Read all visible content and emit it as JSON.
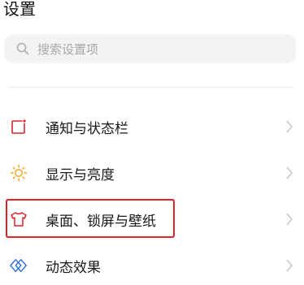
{
  "header": {
    "title": "设置"
  },
  "search": {
    "placeholder": "搜索设置项"
  },
  "settings": {
    "items": [
      {
        "label": "通知与状态栏",
        "icon": "notification-icon"
      },
      {
        "label": "显示与亮度",
        "icon": "brightness-sun-icon"
      },
      {
        "label": "桌面、锁屏与壁纸",
        "icon": "tshirt-icon"
      },
      {
        "label": "动态效果",
        "icon": "animation-diamond-icon"
      }
    ]
  },
  "colors": {
    "notification_icon": "#d9272e",
    "brightness_icon": "#f5a623",
    "tshirt_icon": "#e0222a",
    "animation_icon": "#2a6fd6",
    "highlight_border": "#e0222a"
  }
}
